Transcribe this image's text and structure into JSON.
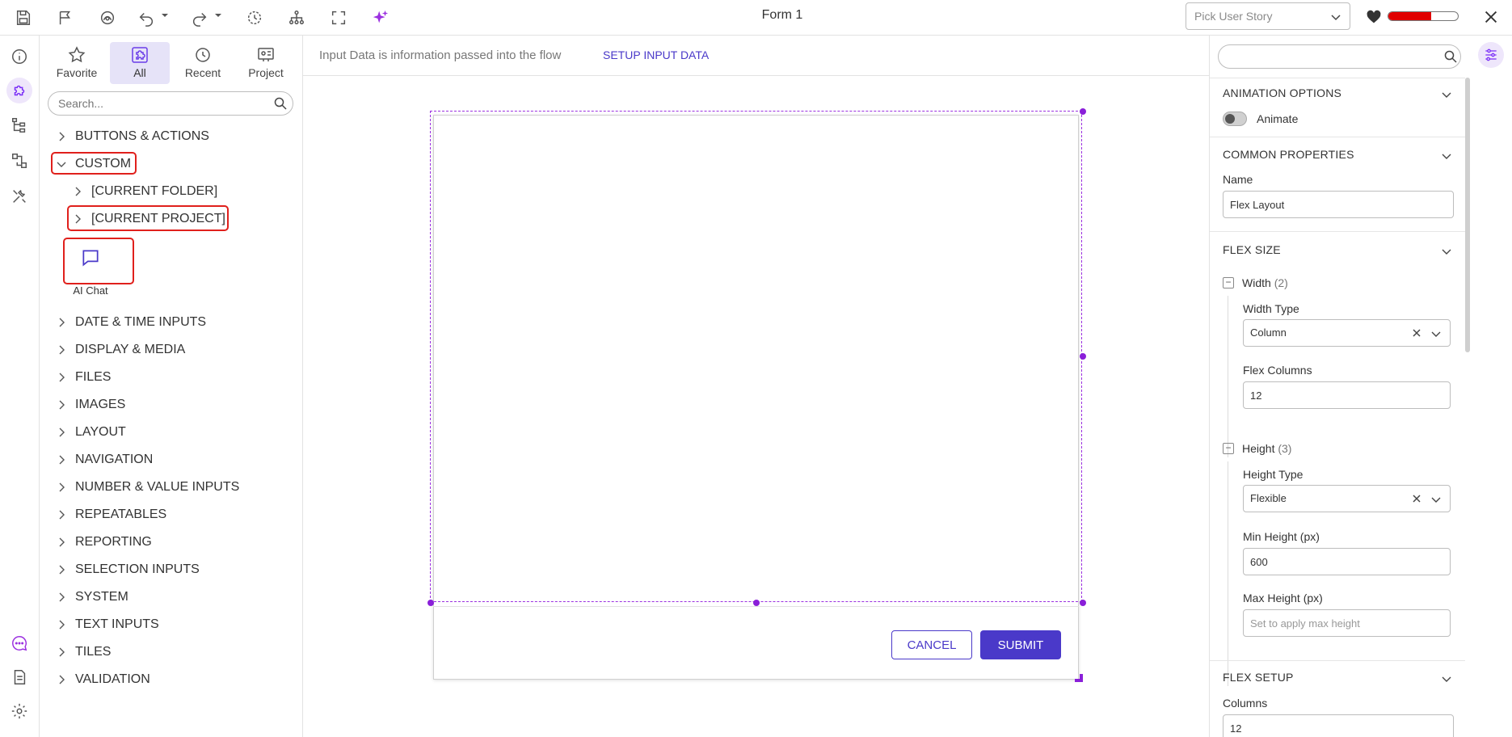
{
  "window": {
    "form_title": "Form 1"
  },
  "topbar": {
    "story_placeholder": "Pick User Story",
    "health_percent": 62,
    "health_color": "#e00000",
    "icons": [
      "save-icon",
      "flag-icon",
      "preview-icon",
      "undo-icon",
      "redo-icon",
      "history-icon",
      "hierarchy-icon",
      "fullscreen-icon",
      "ai-sparkle-icon"
    ]
  },
  "left_rail": {
    "icons": [
      "info-icon",
      "components-icon",
      "tree-icon",
      "flow-icon",
      "tools-icon",
      "chat-icon",
      "document-icon",
      "settings-icon"
    ]
  },
  "panel": {
    "tabs": [
      {
        "label": "Favorite",
        "icon": "star-icon"
      },
      {
        "label": "All",
        "icon": "puzzle-icon"
      },
      {
        "label": "Recent",
        "icon": "clock-icon"
      },
      {
        "label": "Project",
        "icon": "project-icon"
      }
    ],
    "search_placeholder": "Search...",
    "categories": {
      "buttons": "BUTTONS & ACTIONS",
      "custom": "CUSTOM",
      "current_folder": "[CURRENT FOLDER]",
      "current_project": "[CURRENT PROJECT]",
      "ai_chat": "AI Chat",
      "date_time": "DATE & TIME INPUTS",
      "display": "DISPLAY & MEDIA",
      "files": "FILES",
      "images": "IMAGES",
      "layout": "LAYOUT",
      "navigation": "NAVIGATION",
      "number": "NUMBER & VALUE INPUTS",
      "repeatables": "REPEATABLES",
      "reporting": "REPORTING",
      "selection": "SELECTION INPUTS",
      "system": "SYSTEM",
      "text": "TEXT INPUTS",
      "tiles": "TILES",
      "validation": "VALIDATION"
    }
  },
  "canvas": {
    "info_text": "Input Data is information passed into the flow",
    "setup_link": "SETUP INPUT DATA",
    "cancel_label": "CANCEL",
    "submit_label": "SUBMIT",
    "accent": "#4a39c9",
    "selection_color": "#8a1fd9"
  },
  "props": {
    "search_value": "",
    "animation": {
      "title": "ANIMATION OPTIONS",
      "toggle_label": "Animate"
    },
    "common": {
      "title": "COMMON PROPERTIES",
      "name_label": "Name",
      "name_value": "Flex Layout"
    },
    "flex_size": {
      "title": "FLEX SIZE",
      "width_label": "Width",
      "width_count": "(2)",
      "width_type_label": "Width Type",
      "width_type_value": "Column",
      "flex_columns_label": "Flex Columns",
      "flex_columns_value": "12",
      "height_label": "Height",
      "height_count": "(3)",
      "height_type_label": "Height Type",
      "height_type_value": "Flexible",
      "min_height_label": "Min Height (px)",
      "min_height_value": "600",
      "max_height_label": "Max Height (px)",
      "max_height_placeholder": "Set to apply max height"
    },
    "flex_setup": {
      "title": "FLEX SETUP",
      "columns_label": "Columns",
      "columns_value": "12"
    }
  }
}
